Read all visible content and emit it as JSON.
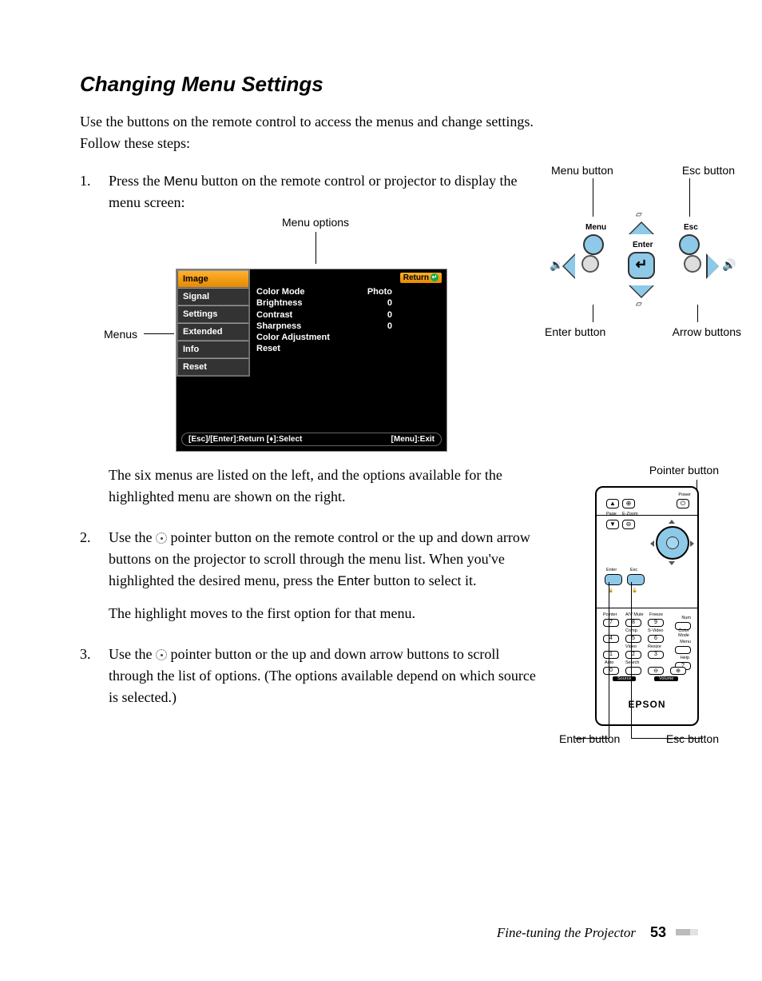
{
  "title": "Changing Menu Settings",
  "intro": "Use the buttons on the remote control to access the menus and change settings. Follow these steps:",
  "steps": {
    "s1": {
      "num": "1.",
      "pre": "Press the ",
      "btn": "Menu",
      "post": " button on the remote control or projector to display the menu screen:",
      "after1": "The six menus are listed on the left, and the options available for the highlighted menu are shown on the right."
    },
    "s2": {
      "num": "2.",
      "pre": "Use the ",
      "mid": " pointer button on the remote control or the up and down arrow buttons on the projector to scroll through the menu list. When you've highlighted the desired menu, press the ",
      "btn": "Enter",
      "post": " button to select it.",
      "after1": "The highlight moves to the first option for that menu."
    },
    "s3": {
      "num": "3.",
      "pre": "Use the ",
      "post": " pointer button or the up and down arrow buttons to scroll through the list of options. (The options available depend on which source is selected.)"
    }
  },
  "menu_fig": {
    "options_label": "Menu options",
    "menus_label": "Menus",
    "return": "Return",
    "items": [
      "Image",
      "Signal",
      "Settings",
      "Extended",
      "Info",
      "Reset"
    ],
    "opts": [
      {
        "k": "Color Mode",
        "v": "Photo"
      },
      {
        "k": "Brightness",
        "v": "0"
      },
      {
        "k": "Contrast",
        "v": "0"
      },
      {
        "k": "Sharpness",
        "v": "0"
      },
      {
        "k": "Color Adjustment",
        "v": ""
      },
      {
        "k": "Reset",
        "v": ""
      }
    ],
    "footer_left": "[Esc]/[Enter]:Return [♦]:Select",
    "footer_right": "[Menu]:Exit"
  },
  "panel": {
    "menu_button": "Menu button",
    "esc_button": "Esc button",
    "menu": "Menu",
    "esc": "Esc",
    "enter": "Enter",
    "enter_button": "Enter button",
    "arrow_buttons": "Arrow buttons"
  },
  "remote": {
    "pointer_button": "Pointer button",
    "enter_button": "Enter button",
    "esc_button": "Esc button",
    "brand": "EPSON",
    "labels": {
      "power": "Power",
      "page": "Page",
      "ezoom": "E-Zoom",
      "enter": "Enter",
      "esc": "Esc",
      "pointer": "Pointer",
      "avmute": "A/V Mute",
      "freeze": "Freeze",
      "num": "Num",
      "comp": "Comp.",
      "svideo": "S-Video",
      "color": "Color\nMode",
      "menu": "Menu",
      "video": "Video",
      "resize": "Resize",
      "help": "Help",
      "auto": "Auto",
      "search": "Search",
      "source": "Source",
      "volume": "Volume",
      "n1": "1",
      "n2": "2",
      "n3": "3",
      "n4": "4",
      "n5": "5",
      "n6": "6",
      "n7": "7",
      "n8": "8",
      "n9": "9",
      "n0": "0",
      "up": "▲",
      "down": "▼",
      "plus": "⊕",
      "minus": "⊖",
      "lock": "🔒",
      "unlock": "🔓",
      "volminus": "⊖",
      "volplus": "⊕"
    }
  },
  "footer": {
    "title": "Fine-tuning the Projector",
    "page": "53"
  }
}
